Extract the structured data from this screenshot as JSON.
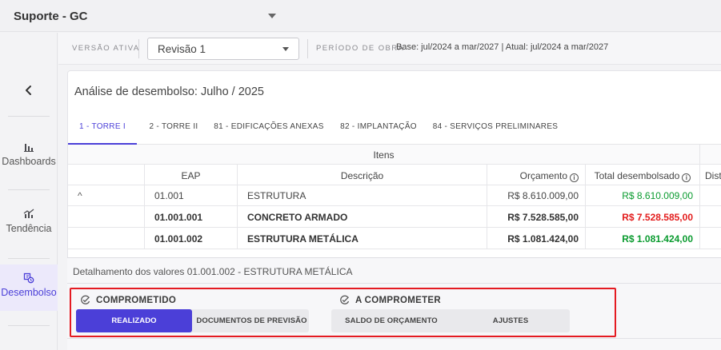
{
  "topbar": {
    "project": "Suporte - GC"
  },
  "sidebar": {
    "items": [
      {
        "label": "Dashboards",
        "icon": "bar-chart-icon"
      },
      {
        "label": "Tendência",
        "icon": "trend-icon"
      },
      {
        "label": "Desembolso",
        "icon": "disbursement-icon"
      }
    ],
    "active": "Desembolso",
    "accent": "#4b3fd8"
  },
  "versionbar": {
    "version_label": "VERSÃO ATIVA",
    "revision": "Revisão 1",
    "period_label": "PERÍODO DE OBRA",
    "period_value": "Base: jul/2024 a mar/2027 | Atual: jul/2024 a mar/2027"
  },
  "card": {
    "title": "Análise de desembolso: Julho / 2025",
    "tabs": [
      "1 - TORRE I",
      "2 - TORRE II",
      "81 - EDIFICAÇÕES ANEXAS",
      "82 - IMPLANTAÇÃO",
      "84 - SERVIÇOS PRELIMINARES"
    ],
    "active_tab": "1 - TORRE I"
  },
  "table": {
    "group_header": "Itens",
    "columns": [
      "EAP",
      "Descrição",
      "Orçamento",
      "Total desembolsado",
      "Dist"
    ],
    "rows": [
      {
        "eap": "01.001",
        "desc": "ESTRUTURA",
        "budget": "R$ 8.610.009,00",
        "total": "R$ 8.610.009,00",
        "total_color": "green",
        "bold": false,
        "expand": "^"
      },
      {
        "eap": "01.001.001",
        "desc": "CONCRETO ARMADO",
        "budget": "R$ 7.528.585,00",
        "total": "R$ 7.528.585,00",
        "total_color": "red",
        "bold": true,
        "expand": ""
      },
      {
        "eap": "01.001.002",
        "desc": "ESTRUTURA METÁLICA",
        "budget": "R$ 1.081.424,00",
        "total": "R$ 1.081.424,00",
        "total_color": "green",
        "bold": true,
        "expand": ""
      }
    ]
  },
  "detail": {
    "title": "Detalhamento dos valores 01.001.002 - ESTRUTURA METÁLICA",
    "committed": {
      "heading": "COMPROMETIDO",
      "buttons": [
        "REALIZADO",
        "DOCUMENTOS DE PREVISÃO"
      ],
      "active": "REALIZADO"
    },
    "to_commit": {
      "heading": "A COMPROMETER",
      "buttons": [
        "SALDO DE ORÇAMENTO",
        "AJUSTES"
      ]
    }
  },
  "colors": {
    "accent": "#4b3fd8",
    "positive": "#0a9b2f",
    "negative": "#e31c1c",
    "highlight": "#e41b22"
  }
}
